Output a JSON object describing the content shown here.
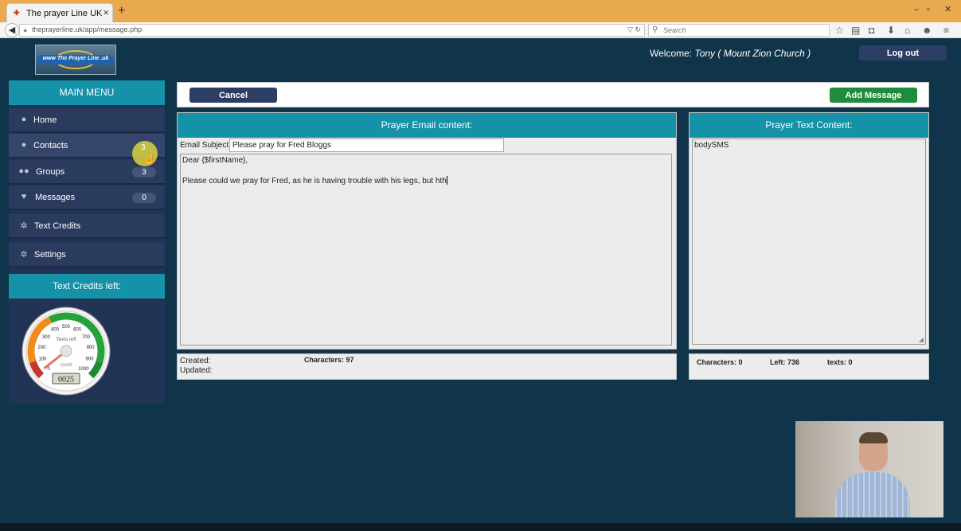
{
  "browser": {
    "tab_title": "The prayer Line UK",
    "tab_close": "×",
    "new_tab": "+",
    "window_controls": [
      "–",
      "▫",
      "✕"
    ],
    "url": "theprayerline.uk/app/message.php",
    "search_placeholder": "Search"
  },
  "header": {
    "logo_text": "www   The Prayer Line  .uk",
    "welcome_prefix": "Welcome: ",
    "welcome_user": "Tony ( Mount Zion Church )",
    "logout_label": "Log out"
  },
  "sidebar": {
    "menu_title": "MAIN MENU",
    "items": [
      {
        "label": "Home",
        "icon": "user-icon",
        "badge": null
      },
      {
        "label": "Contacts",
        "icon": "user-icon",
        "badge": "3"
      },
      {
        "label": "Groups",
        "icon": "group-icon",
        "badge": "3"
      },
      {
        "label": "Messages",
        "icon": "heart-icon",
        "badge": "0"
      },
      {
        "label": "Text Credits",
        "icon": "gear-icon",
        "badge": null
      },
      {
        "label": "Settings",
        "icon": "gear-icon",
        "badge": null
      }
    ],
    "credits_title": "Text Credits left:",
    "gauge": {
      "label_top": "Texts left",
      "label_bottom": "credit",
      "ticks": [
        "0",
        "100",
        "200",
        "300",
        "400",
        "500",
        "600",
        "700",
        "800",
        "900",
        "1000"
      ],
      "readout": "0025",
      "value": 25,
      "max": 1000
    }
  },
  "actions": {
    "cancel_label": "Cancel",
    "add_label": "Add Message"
  },
  "email": {
    "title": "Prayer Email content:",
    "subject_label": "Email Subject:",
    "subject_value": "Please pray for Fred Bloggs",
    "body_line1": "Dear {$firstName},",
    "body_line2": "Please could we pray for Fred, as he is having trouble with his legs, but hth",
    "created_label": "Created:",
    "updated_label": "Updated:",
    "characters": "Characters: 97"
  },
  "sms": {
    "title": "Prayer Text Content:",
    "body": "bodySMS",
    "characters": "Characters: 0",
    "left": "Left: 736",
    "texts": "texts: 0"
  },
  "colors": {
    "page_bg": "#10354a",
    "teal_header": "#1591a8",
    "navy_button": "#2c3e63",
    "green_button": "#1e8c3a",
    "browser_titlebar": "#e9a94f"
  }
}
